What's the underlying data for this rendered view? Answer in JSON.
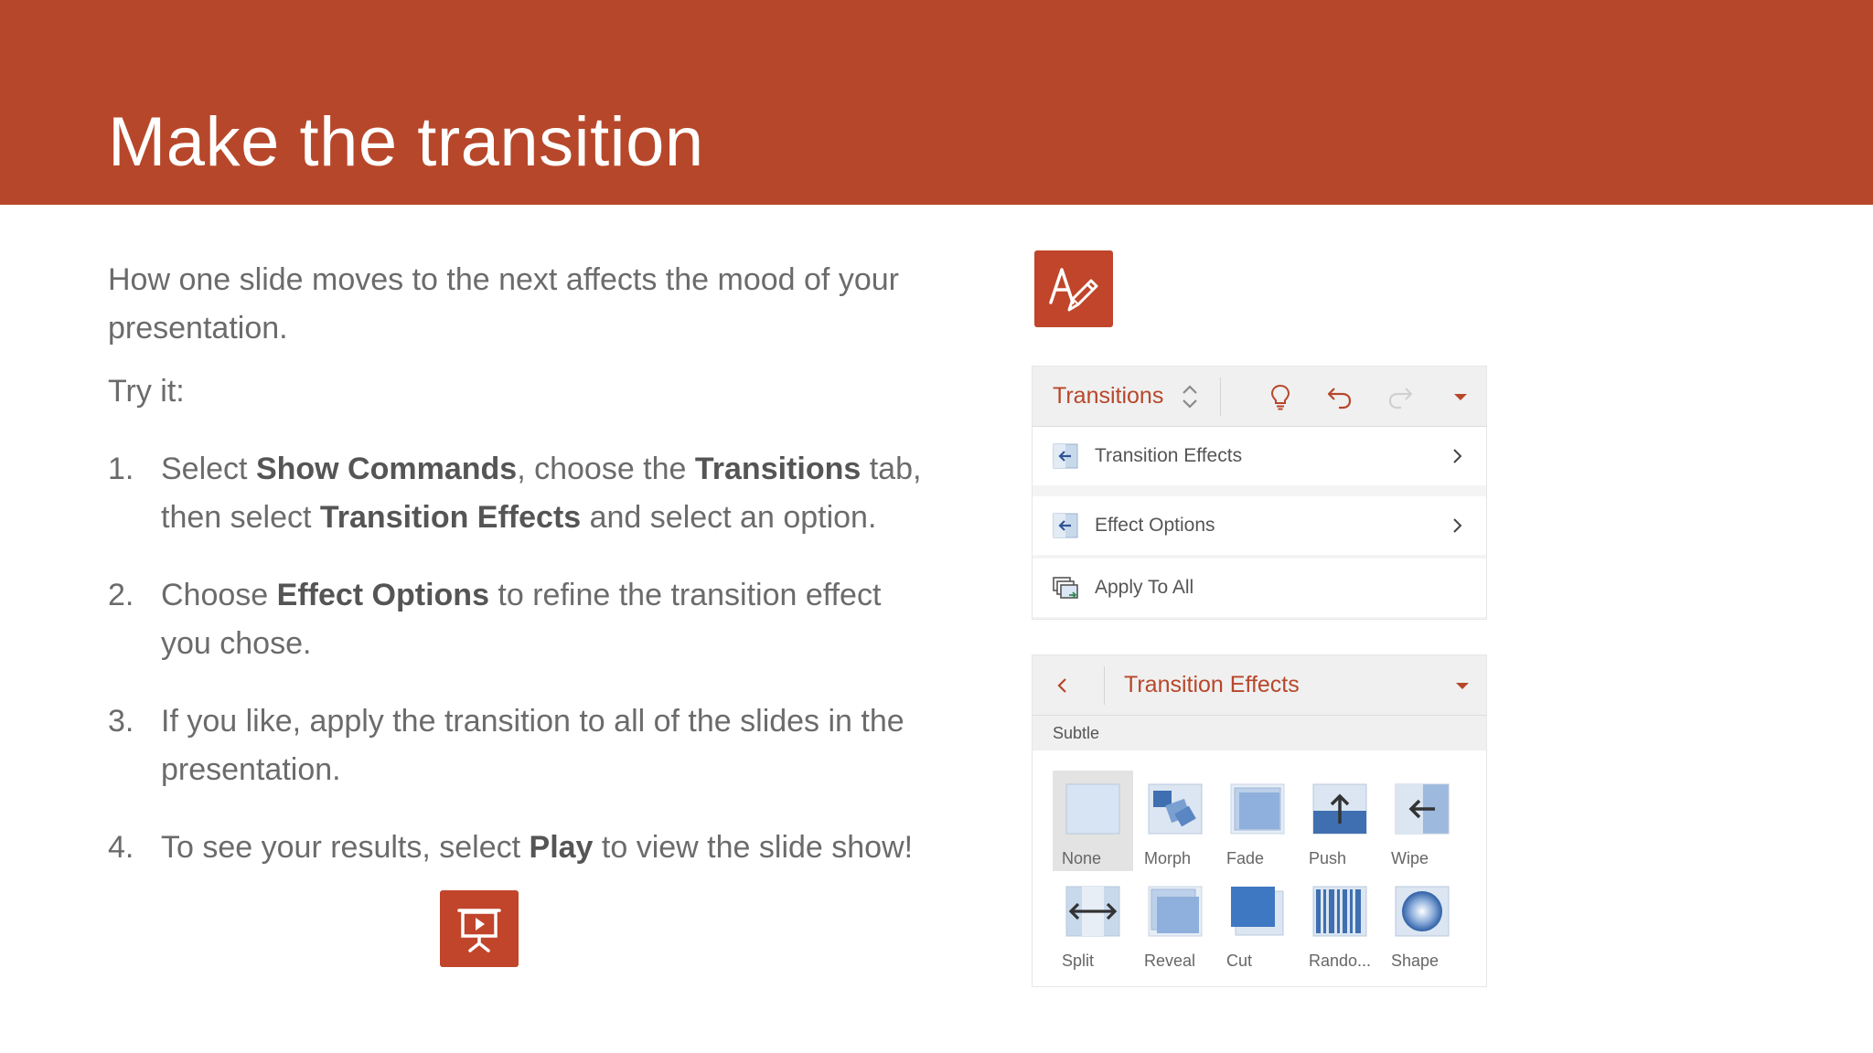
{
  "slide": {
    "title": "Make the transition",
    "intro": "How one slide moves to the next affects the mood of your presentation.",
    "try_it": "Try it:",
    "steps": [
      {
        "num": "1.",
        "parts": [
          "Select ",
          "Show Commands",
          ", choose the ",
          "Transitions",
          " tab, then select ",
          "Transition Effects",
          " and select an option."
        ]
      },
      {
        "num": "2.",
        "parts": [
          "Choose ",
          "Effect Options",
          " to refine the transition effect you chose."
        ]
      },
      {
        "num": "3.",
        "parts": [
          "If you like, apply the transition to all of the slides in the presentation."
        ]
      },
      {
        "num": "4.",
        "parts": [
          "To see your results, select ",
          "Play",
          " to view the slide show!"
        ]
      }
    ]
  },
  "icons": {
    "design_tile": "design-pen-icon",
    "play_tile": "play-slideshow-icon"
  },
  "colors": {
    "accent": "#b7472a",
    "banner": "#b7472a",
    "body_text": "#6b6b6b",
    "thumb_blue": "#4a7ebb"
  },
  "ribbon_panel": {
    "tab_label": "Transitions",
    "rows": [
      {
        "label": "Transition Effects",
        "icon": "transition-effects-icon",
        "has_chevron": true
      },
      {
        "label": "Effect Options",
        "icon": "effect-options-icon",
        "has_chevron": true
      },
      {
        "label": "Apply To All",
        "icon": "apply-to-all-icon",
        "has_chevron": false
      }
    ]
  },
  "effects_panel": {
    "title": "Transition Effects",
    "section": "Subtle",
    "effects": [
      {
        "label": "None",
        "selected": true
      },
      {
        "label": "Morph",
        "selected": false
      },
      {
        "label": "Fade",
        "selected": false
      },
      {
        "label": "Push",
        "selected": false
      },
      {
        "label": "Wipe",
        "selected": false
      },
      {
        "label": "Split",
        "selected": false
      },
      {
        "label": "Reveal",
        "selected": false
      },
      {
        "label": "Cut",
        "selected": false
      },
      {
        "label": "Rando...",
        "selected": false
      },
      {
        "label": "Shape",
        "selected": false
      }
    ]
  }
}
